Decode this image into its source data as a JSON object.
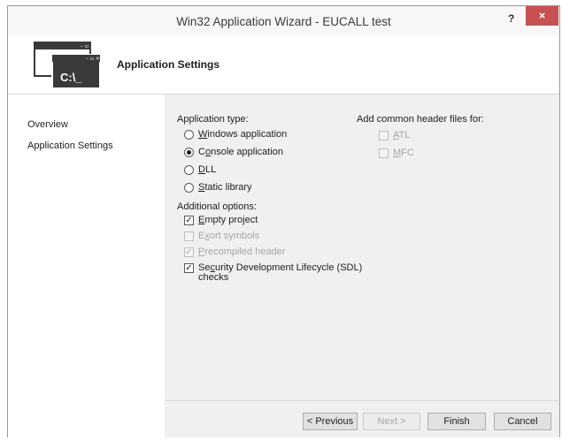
{
  "window": {
    "title": "Win32 Application Wizard - EUCALL test",
    "help": "?",
    "close": "×"
  },
  "header": {
    "title": "Application Settings",
    "icon_text": "C:\\_"
  },
  "nav": {
    "items": [
      {
        "label": "Overview"
      },
      {
        "label": "Application Settings"
      }
    ]
  },
  "app_type": {
    "label": "Application type:",
    "options": [
      {
        "label": "Windows application",
        "selected": false
      },
      {
        "label": "Console application",
        "selected": true
      },
      {
        "label": "DLL",
        "selected": false
      },
      {
        "label": "Static library",
        "selected": false
      }
    ]
  },
  "additional": {
    "label": "Additional options:",
    "options": [
      {
        "label": "Empty project",
        "checked": true,
        "enabled": true
      },
      {
        "label": "Export symbols",
        "checked": false,
        "enabled": false
      },
      {
        "label": "Precompiled header",
        "checked": true,
        "enabled": false
      },
      {
        "label": "Security Development Lifecycle (SDL)",
        "label2": "checks",
        "checked": true,
        "enabled": true
      }
    ]
  },
  "common_headers": {
    "label": "Add common header files for:",
    "options": [
      {
        "label": "ATL",
        "checked": false,
        "enabled": false
      },
      {
        "label": "MFC",
        "checked": false,
        "enabled": false
      }
    ]
  },
  "buttons": {
    "previous": "< Previous",
    "next": "Next >",
    "finish": "Finish",
    "cancel": "Cancel"
  },
  "colors": {
    "close_bg": "#c75050",
    "window_bg": "#f0f0f0",
    "header_bg": "#ffffff"
  }
}
